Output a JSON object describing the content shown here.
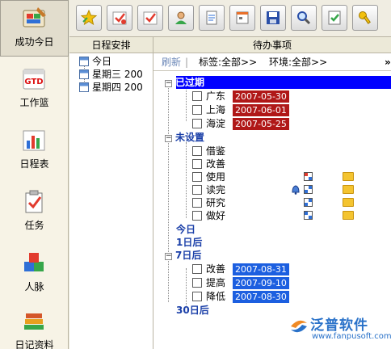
{
  "leftnav": {
    "items": [
      {
        "label": "成功今日",
        "icon": "palette-icon",
        "active": true
      },
      {
        "label": "工作篮",
        "icon": "gtd-icon",
        "icon_text": "GTD"
      },
      {
        "label": "日程表",
        "icon": "calendar-chart-icon"
      },
      {
        "label": "任务",
        "icon": "task-clipboard-icon"
      },
      {
        "label": "人脉",
        "icon": "blocks-icon"
      },
      {
        "label": "日记资料",
        "icon": "books-icon"
      }
    ]
  },
  "toolbar": {
    "buttons": [
      "star-icon",
      "check-calendar-icon",
      "check-icon",
      "person-icon",
      "document-icon",
      "form-icon",
      "save-icon",
      "search-icon",
      "approve-icon",
      "key-icon"
    ]
  },
  "schedule": {
    "header": "日程安排",
    "items": [
      {
        "label": "今日"
      },
      {
        "label": "星期三 200"
      },
      {
        "label": "星期四 200"
      }
    ]
  },
  "todo": {
    "header": "待办事项",
    "refresh": "刷新",
    "tag_filter": "标签:全部>>",
    "env_filter": "环境:全部>>",
    "more": "»",
    "groups": [
      {
        "title": "已过期",
        "items": [
          {
            "name": "广东",
            "date": "2007-05-30"
          },
          {
            "name": "上海",
            "date": "2007-06-01"
          },
          {
            "name": "海淀",
            "date": "2007-05-25"
          }
        ]
      },
      {
        "title": "未设置",
        "items": [
          {
            "name": "借鉴"
          },
          {
            "name": "改善"
          },
          {
            "name": "使用"
          },
          {
            "name": "读完"
          },
          {
            "name": "研究"
          },
          {
            "name": "做好"
          }
        ]
      },
      {
        "title": "今日"
      },
      {
        "title": "1日后"
      },
      {
        "title": "7日后",
        "items": [
          {
            "name": "改善",
            "date": "2007-08-31"
          },
          {
            "name": "提高",
            "date": "2007-09-10"
          },
          {
            "name": "降低",
            "date": "2007-08-30"
          }
        ]
      },
      {
        "title": "30日后"
      }
    ]
  },
  "watermark": {
    "brand": "泛普软件",
    "url": "www.fanpusoft.com"
  },
  "colors": {
    "overdue": "#b01818",
    "upcoming": "#1c5fe0",
    "group_text": "#1a3fa8",
    "selected": "#0000ff"
  }
}
